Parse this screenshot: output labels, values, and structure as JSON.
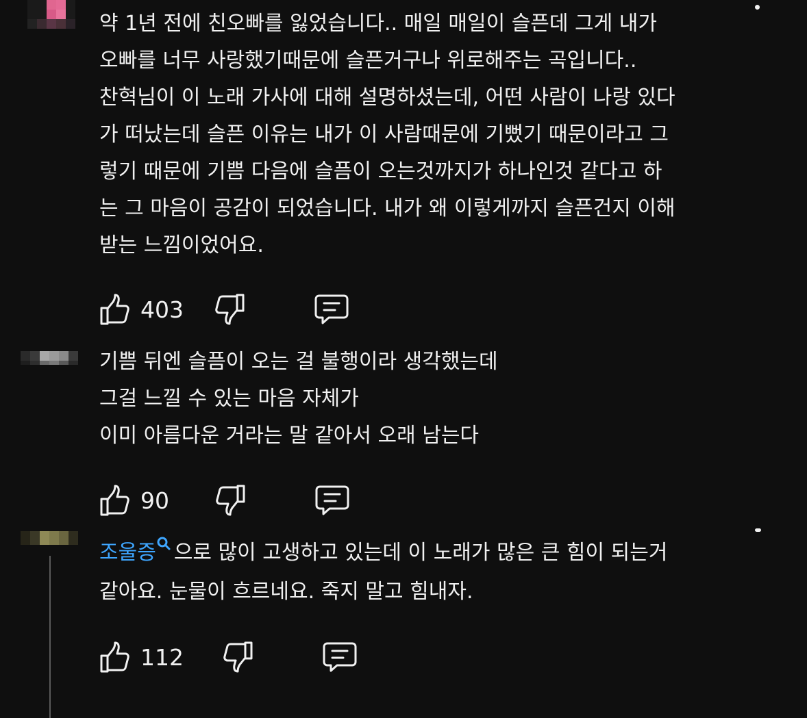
{
  "comments": [
    {
      "lines": [
        "약 1년 전에 친오빠를 잃었습니다..  매일 매일이 슬픈데 그게 내가",
        "오빠를 너무 사랑했기때문에 슬픈거구나 위로해주는 곡입니다..",
        "찬혁님이 이 노래 가사에 대해 설명하셨는데, 어떤 사람이 나랑 있다",
        "가 떠났는데 슬픈 이유는 내가 이 사람때문에 기뻤기 때문이라고 그",
        "렇기 때문에 기쁨 다음에 슬픔이 오는것까지가 하나인것 같다고 하",
        "는 그 마음이 공감이 되었습니다. 내가 왜 이렇게까지 슬픈건지 이해",
        "받는 느낌이었어요."
      ],
      "likes": "403",
      "avatar_colors": [
        "#e65c8a",
        "#f06b99",
        "#d94d7d"
      ]
    },
    {
      "lines": [
        "기쁨 뒤엔 슬픔이 오는 걸 불행이라 생각했는데",
        "그걸 느낄 수 있는 마음 자체가",
        "이미 아름다운 거라는 말 같아서 오래 남는다"
      ],
      "likes": "90",
      "avatar_colors": [
        "#3a3a3a",
        "#9a9a9a",
        "#6a6a6a"
      ]
    },
    {
      "hashtag": "조울증",
      "line1_rest": "으로 많이 고생하고 있는데 이 노래가 많은 큰 힘이 되는거",
      "line2": "같아요. 눈물이 흐르네요. 죽지 말고 힘내자.",
      "likes": "112",
      "avatar_colors": [
        "#4a4630",
        "#8a8550",
        "#6e6a40"
      ]
    }
  ],
  "icons": {
    "like": "thumbs-up-icon",
    "dislike": "thumbs-down-icon",
    "reply": "comment-reply-icon",
    "menu": "more-vertical-icon",
    "search": "search-icon"
  },
  "colors": {
    "background": "#0f0f0f",
    "text": "#f1f1f1",
    "link": "#3ea6ff"
  }
}
